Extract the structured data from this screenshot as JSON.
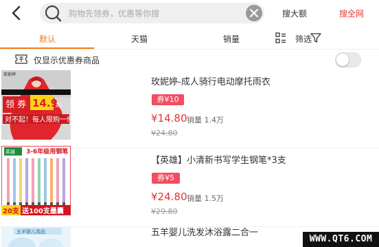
{
  "header": {
    "search_placeholder": "购物先领券，优惠等你搜",
    "search_coupon_label": "搜大额",
    "search_all_label": "搜全网"
  },
  "tabs": [
    {
      "label": "默认",
      "active": true
    },
    {
      "label": "天猫",
      "active": false
    },
    {
      "label": "销量",
      "active": false
    }
  ],
  "filter_label": "筛选",
  "coupon_only_label": "仅显示优惠券商品",
  "coupon_only_enabled": false,
  "products": [
    {
      "title": "玫妮婷-成人骑行电动摩托雨衣",
      "coupon": "券¥10",
      "price": "¥14.80",
      "sales": "销量 1.4万",
      "original_price": "¥24.80",
      "thumb": {
        "brand": "玫妮婷",
        "badge_prefix": "领 券",
        "badge_value": "14.9",
        "badge_unit": "起",
        "slogan": "对不起！每人限购一件"
      }
    },
    {
      "title": "【英雄】小清新书写学生钢笔*3支",
      "coupon": "券¥5",
      "price": "¥24.80",
      "sales": "销量 1.5万",
      "original_price": "¥29.80",
      "thumb": {
        "brand": "英雄",
        "headline": "3-6年级用钢笔",
        "left_tag": "20支",
        "bottom_text": "送100支墨囊"
      }
    },
    {
      "title": "五羊婴儿洗发沐浴露二合一",
      "thumb": {
        "brand": "五羊婴儿用品"
      }
    }
  ],
  "watermark": "WWW.QT6.COM",
  "colors": {
    "accent": "#f07a1a",
    "price": "#e8332d",
    "badge": "#f24e62",
    "search_all": "#e23a3a"
  }
}
